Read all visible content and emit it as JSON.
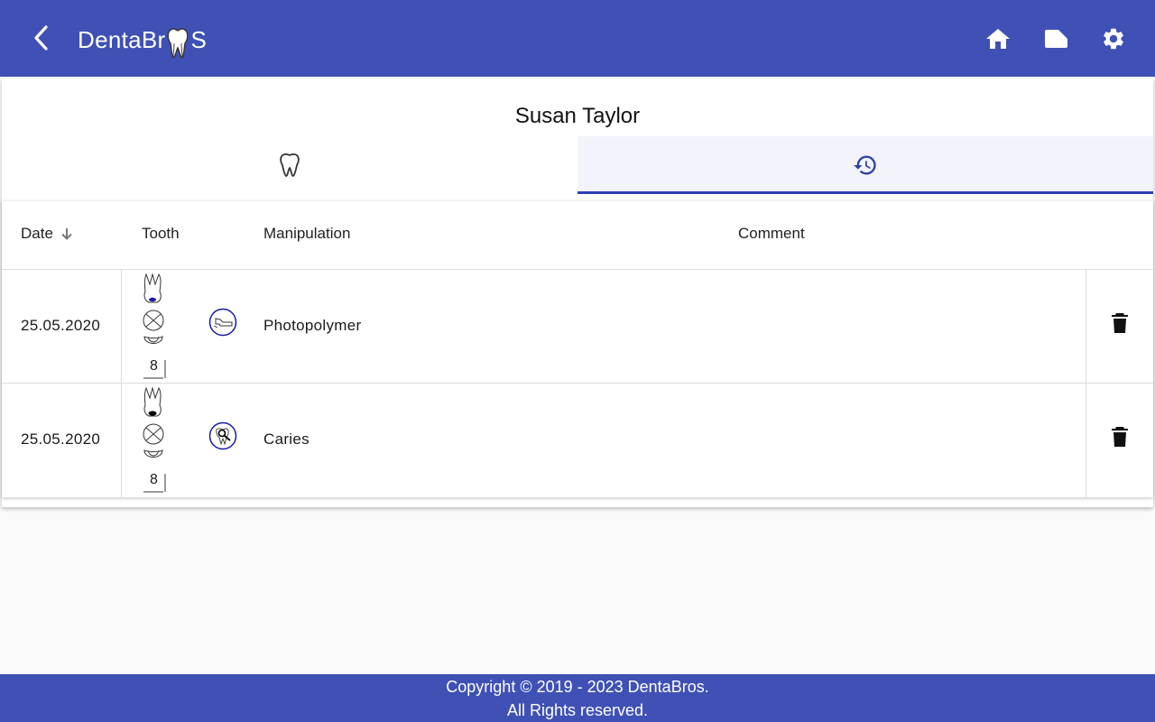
{
  "header": {
    "brand_prefix": "DentaBr",
    "brand_suffix": "S",
    "icons": [
      "back-arrow-icon",
      "home-icon",
      "label-icon",
      "gear-icon"
    ]
  },
  "patient": {
    "name": "Susan Taylor"
  },
  "tabs": [
    {
      "icon": "tooth-icon",
      "active": false
    },
    {
      "icon": "history-icon",
      "active": true
    }
  ],
  "table": {
    "columns": {
      "date": "Date",
      "tooth": "Tooth",
      "manipulation": "Manipulation",
      "comment": "Comment"
    },
    "sort_icon": "arrow-down-icon",
    "rows": [
      {
        "date": "25.05.2020",
        "tooth_number": "8",
        "manipulation": "Photopolymer",
        "manipulation_icon": "photopolymer-icon",
        "comment": ""
      },
      {
        "date": "25.05.2020",
        "tooth_number": "8",
        "manipulation": "Caries",
        "manipulation_icon": "caries-icon",
        "comment": ""
      }
    ]
  },
  "footer": {
    "line1": "Copyright © 2019 - 2023 DentaBros.",
    "line2": "All Rights reserved."
  },
  "colors": {
    "primary": "#3f51b5",
    "accent": "#2f3fb0",
    "filling_photopolymer": "#1a1aa8",
    "filling_caries": "#000000"
  }
}
